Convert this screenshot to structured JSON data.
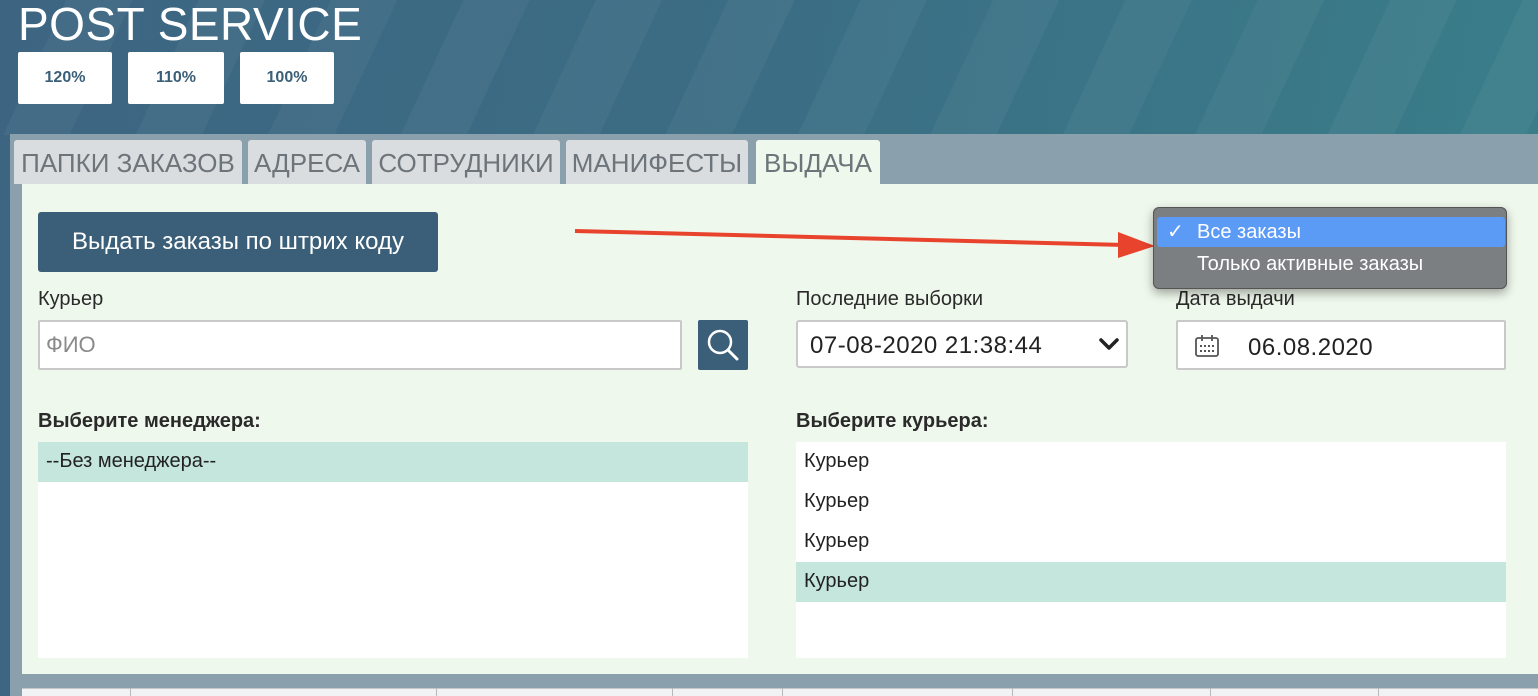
{
  "app": {
    "title": "POST SERVICE"
  },
  "zoom": {
    "options": [
      "120%",
      "110%",
      "100%"
    ]
  },
  "tabs": [
    "ПАПКИ ЗАКАЗОВ",
    "АДРЕСА",
    "СОТРУДНИКИ",
    "МАНИФЕСТЫ",
    "ВЫДАЧА"
  ],
  "active_tab": "ВЫДАЧА",
  "actions": {
    "issue_by_barcode": "Выдать заказы по штрих коду"
  },
  "courier_field": {
    "label": "Курьер",
    "placeholder": "ФИО",
    "value": ""
  },
  "recent": {
    "label": "Последние выборки",
    "value": "07-08-2020 21:38:44"
  },
  "issue_date": {
    "label": "Дата выдачи",
    "value": "06.08.2020"
  },
  "filter_dropdown": {
    "options": [
      "Все заказы",
      "Только активные заказы"
    ],
    "selected": "Все заказы"
  },
  "managers": {
    "label": "Выберите менеджера:",
    "items": [
      "--Без менеджера--"
    ]
  },
  "couriers": {
    "label": "Выберите курьера:",
    "items": [
      "Курьер",
      "Курьер",
      "Курьер",
      "Курьер"
    ]
  },
  "colors": {
    "primary": "#3b5f78",
    "selected_row": "#c5e6dc",
    "annotation_arrow": "#e8432d",
    "dropdown_highlight": "#5b9bf6"
  }
}
